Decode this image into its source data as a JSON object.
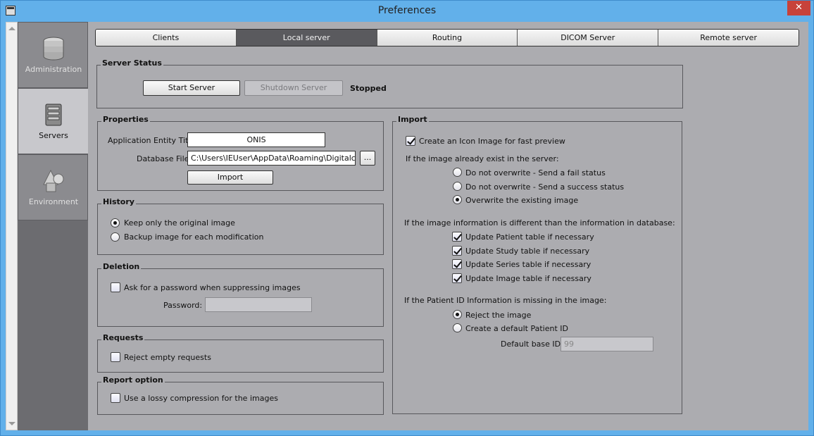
{
  "window": {
    "title": "Preferences",
    "close_glyph": "✕"
  },
  "sidebar": {
    "items": [
      {
        "label": "Administration",
        "icon": "database-icon",
        "active": false
      },
      {
        "label": "Servers",
        "icon": "server-icon",
        "active": true
      },
      {
        "label": "Environment",
        "icon": "shapes-icon",
        "active": false
      }
    ]
  },
  "tabs": [
    "Clients",
    "Local server",
    "Routing",
    "DICOM Server",
    "Remote server"
  ],
  "active_tab": "Local server",
  "server_status": {
    "title": "Server Status",
    "start_label": "Start Server",
    "shutdown_label": "Shutdown Server",
    "status": "Stopped"
  },
  "properties": {
    "title": "Properties",
    "ae_title_label": "Application Entity Title",
    "ae_title_value": "ONIS",
    "db_file_label": "Database File",
    "db_file_value": "C:\\Users\\IEUser\\AppData\\Roaming\\Digitalcore\\ONIS",
    "browse_label": "...",
    "import_label": "Import"
  },
  "history": {
    "title": "History",
    "opt1": "Keep only the original image",
    "opt2": "Backup image for each modification",
    "selected": 1
  },
  "deletion": {
    "title": "Deletion",
    "ask_label": "Ask for a password when suppressing images",
    "ask_checked": false,
    "password_label": "Password:",
    "password_value": ""
  },
  "requests": {
    "title": "Requests",
    "reject_label": "Reject empty requests",
    "reject_checked": false
  },
  "report": {
    "title": "Report option",
    "lossy_label": "Use a lossy compression for the images",
    "lossy_checked": false
  },
  "import": {
    "title": "Import",
    "icon_label": "Create an Icon Image for fast preview",
    "icon_checked": true,
    "exist_heading": "If the image already exist in the server:",
    "exist_opt1": "Do not overwrite - Send a fail status",
    "exist_opt2": "Do not overwrite - Send a success status",
    "exist_opt3": "Overwrite the existing image",
    "exist_selected": 3,
    "diff_heading": "If the image information is different than the information in database:",
    "upd_patient": "Update Patient table if necessary",
    "upd_study": "Update Study table if necessary",
    "upd_series": "Update Series table if necessary",
    "upd_image": "Update Image table if necessary",
    "missing_heading": "If the Patient ID Information is missing in the image:",
    "reject_label": "Reject the image",
    "create_label": "Create a default Patient ID",
    "missing_selected": 1,
    "base_id_label": "Default base ID",
    "base_id_value": "99"
  }
}
